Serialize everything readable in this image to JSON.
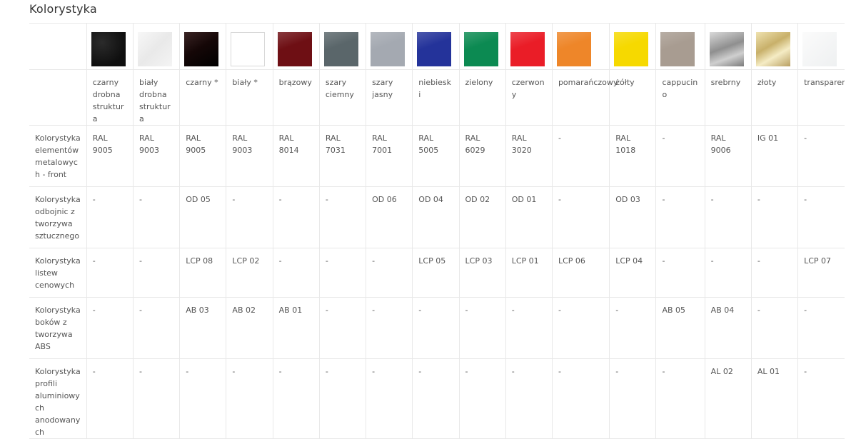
{
  "title": "Kolorystyka",
  "colors": [
    {
      "label": "czarny drobna struktura",
      "swatch": "#141414",
      "style": "texture-dark"
    },
    {
      "label": "biały drobna struktura",
      "swatch": "#f0f0f0",
      "style": "texture-light"
    },
    {
      "label": "czarny *",
      "swatch": "#1c0b0b",
      "style": "gloss-dark"
    },
    {
      "label": "biały *",
      "swatch": "#ffffff",
      "style": "white"
    },
    {
      "label": "brązowy",
      "swatch": "#6e0f14",
      "style": "gloss"
    },
    {
      "label": "szary ciemny",
      "swatch": "#5a666a",
      "style": "gloss"
    },
    {
      "label": "szary jasny",
      "swatch": "#a4a9b1",
      "style": "gloss"
    },
    {
      "label": "niebieski",
      "swatch": "#24339a",
      "style": "gloss"
    },
    {
      "label": "zielony",
      "swatch": "#0c8a52",
      "style": "gloss"
    },
    {
      "label": "czerwony",
      "swatch": "#ea1d27",
      "style": "gloss"
    },
    {
      "label": "pomarańczowy",
      "swatch": "#ee8629",
      "style": "gloss"
    },
    {
      "label": "żółty",
      "swatch": "#f6d900",
      "style": "gloss"
    },
    {
      "label": "cappucino",
      "swatch": "#a89c91",
      "style": "gloss"
    },
    {
      "label": "srebrny",
      "swatch": "#a9a9a9",
      "style": "metal-silver"
    },
    {
      "label": "złoty",
      "swatch": "#d6c78f",
      "style": "metal-gold"
    },
    {
      "label": "transparentny",
      "swatch": "#f6f7f8",
      "style": "transparent"
    }
  ],
  "rows": [
    {
      "label": "Kolorystyka elementów metalowych - front",
      "values": [
        "RAL 9005",
        "RAL 9003",
        "RAL 9005",
        "RAL 9003",
        "RAL 8014",
        "RAL 7031",
        "RAL 7001",
        "RAL 5005",
        "RAL 6029",
        "RAL 3020",
        "-",
        "RAL 1018",
        "-",
        "RAL 9006",
        "IG 01",
        "-"
      ]
    },
    {
      "label": "Kolorystyka odbojnic z tworzywa sztucznego",
      "values": [
        "-",
        "-",
        "OD 05",
        "-",
        "-",
        "-",
        "OD 06",
        "OD 04",
        "OD 02",
        "OD 01",
        "-",
        "OD 03",
        "-",
        "-",
        "-",
        "-"
      ]
    },
    {
      "label": "Kolorystyka listew cenowych",
      "values": [
        "-",
        "-",
        "LCP 08",
        "LCP 02",
        "-",
        "-",
        "-",
        "LCP 05",
        "LCP 03",
        "LCP 01",
        "LCP 06",
        "LCP 04",
        "-",
        "-",
        "-",
        "LCP 07"
      ]
    },
    {
      "label": "Kolorystyka boków z tworzywa ABS",
      "values": [
        "-",
        "-",
        "AB 03",
        "AB 02",
        "AB 01",
        "-",
        "-",
        "-",
        "-",
        "-",
        "-",
        "-",
        "AB 05",
        "AB 04",
        "-",
        "-"
      ]
    },
    {
      "label": "Kolorystyka profili aluminiowych anodowanych",
      "values": [
        "-",
        "-",
        "-",
        "-",
        "-",
        "-",
        "-",
        "-",
        "-",
        "-",
        "-",
        "-",
        "-",
        "AL 02",
        "AL 01",
        "-"
      ]
    }
  ]
}
